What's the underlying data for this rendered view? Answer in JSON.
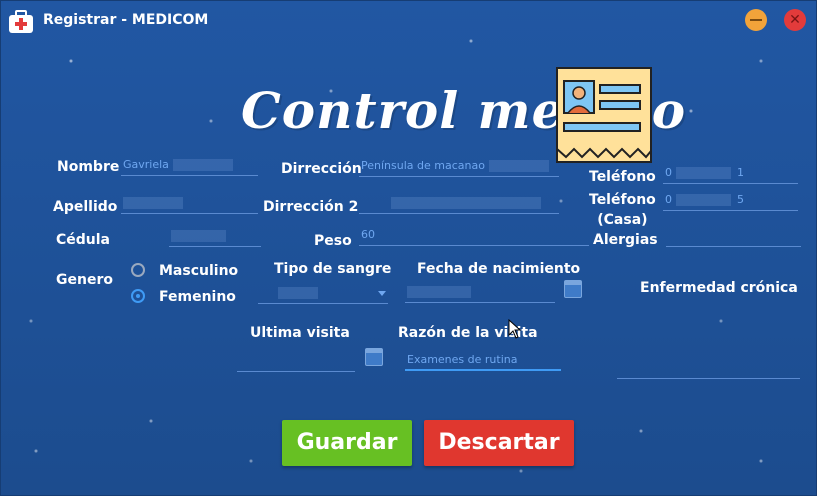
{
  "window": {
    "title": "Registrar - MEDICOM"
  },
  "heading": "Control medico",
  "labels": {
    "nombre": "Nombre",
    "apellido": "Apellido",
    "cedula": "Cédula",
    "genero": "Genero",
    "direccion": "Dirrección",
    "direccion2": "Dirrección 2",
    "peso": "Peso",
    "telefono": "Teléfono",
    "telefono_casa": "Teléfono\n(Casa)",
    "alergias": "Alergias",
    "tipo_sangre": "Tipo de sangre",
    "fecha_nacimiento": "Fecha de nacimiento",
    "enfermedad": "Enfermedad crónica",
    "ultima_visita": "Ultima visita",
    "razon_visita": "Razón de la visita"
  },
  "values": {
    "nombre": "Gavriela",
    "direccion": "Península de macanao",
    "telefono_start": "0",
    "telefono_end": "1",
    "telefono_casa_start": "0",
    "telefono_casa_end": "5",
    "peso": "60",
    "razon_visita": "Examenes de rutina"
  },
  "gender_options": [
    "Masculino",
    "Femenino"
  ],
  "gender_selected": "Femenino",
  "buttons": {
    "save": "Guardar",
    "discard": "Descartar"
  },
  "colors": {
    "background": "#1f4f94",
    "save": "#67c023",
    "discard": "#e0372f",
    "accent": "#3f9bf5"
  }
}
